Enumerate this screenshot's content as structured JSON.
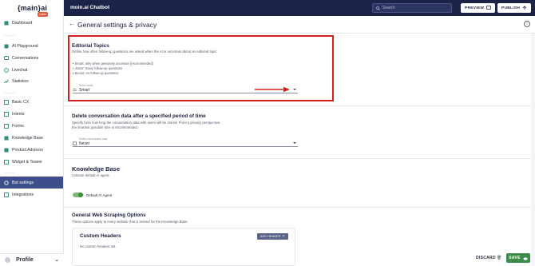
{
  "logo": {
    "text": "{main}ai",
    "badge": "Labs"
  },
  "sidebar": {
    "items": [
      {
        "label": "Dashboard",
        "icon": "dashboard-icon"
      },
      {
        "label": "AI Playground",
        "icon": "sparkle-icon"
      },
      {
        "label": "Conversations",
        "icon": "chat-icon"
      },
      {
        "label": "Livechat",
        "icon": "livechat-icon"
      },
      {
        "label": "Statistics",
        "icon": "chart-icon"
      },
      {
        "label": "Basic CX",
        "icon": "basic-cx-icon"
      },
      {
        "label": "Intents",
        "icon": "intents-icon"
      },
      {
        "label": "Forms",
        "icon": "forms-icon"
      },
      {
        "label": "Knowledge Base",
        "icon": "book-icon"
      },
      {
        "label": "Product Advisors",
        "icon": "cart-icon"
      },
      {
        "label": "Widget & Teaser",
        "icon": "widget-icon"
      },
      {
        "label": "Bot settings",
        "icon": "gear-icon"
      },
      {
        "label": "Integrations",
        "icon": "integrations-icon"
      }
    ],
    "profile": "Profile"
  },
  "topbar": {
    "title": "moin.ai Chatbot",
    "search_placeholder": "Search",
    "preview_label": "PREVIEW",
    "publish_label": "PUBLISH"
  },
  "header": {
    "title": "General settings & privacy"
  },
  "editorial": {
    "title": "Editorial Topics",
    "description": "Define how often follow-up questions are asked when the AI is uncertain about an editorial topic:",
    "bullets": [
      "Smart: only when genuinely uncertain (recommended)",
      "Junior: many follow-up questions",
      "Senior: no follow-up questions"
    ],
    "select_label": "Select mode",
    "select_value": "Smart"
  },
  "delete_data": {
    "title": "Delete conversation data after a specified period of time",
    "description": "Specify here how long the conversation data with users will be stored. From a privacy perspective, the shortest possible time is recommended.",
    "select_label": "Delete conversation data",
    "select_value": "Never"
  },
  "knowledge_base": {
    "title": "Knowledge Base",
    "description": "Activate default AI agent.",
    "toggle_label": "Default AI Agent",
    "toggle_on": true
  },
  "web_scraping": {
    "title": "General Web Scraping Options",
    "description": "These options apply to every website that is trained for the Knowledge Base."
  },
  "custom_headers": {
    "title": "Custom Headers",
    "add_label": "ADD HEADER",
    "empty_text": "No custom headers set."
  },
  "footer": {
    "discard_label": "DISCARD",
    "save_label": "SAVE"
  },
  "colors": {
    "sidebar_active": "#3d4f8a",
    "topbar": "#1b2349",
    "highlight": "#d42020",
    "arrow": "#d42020",
    "save": "#3d8c4a"
  }
}
